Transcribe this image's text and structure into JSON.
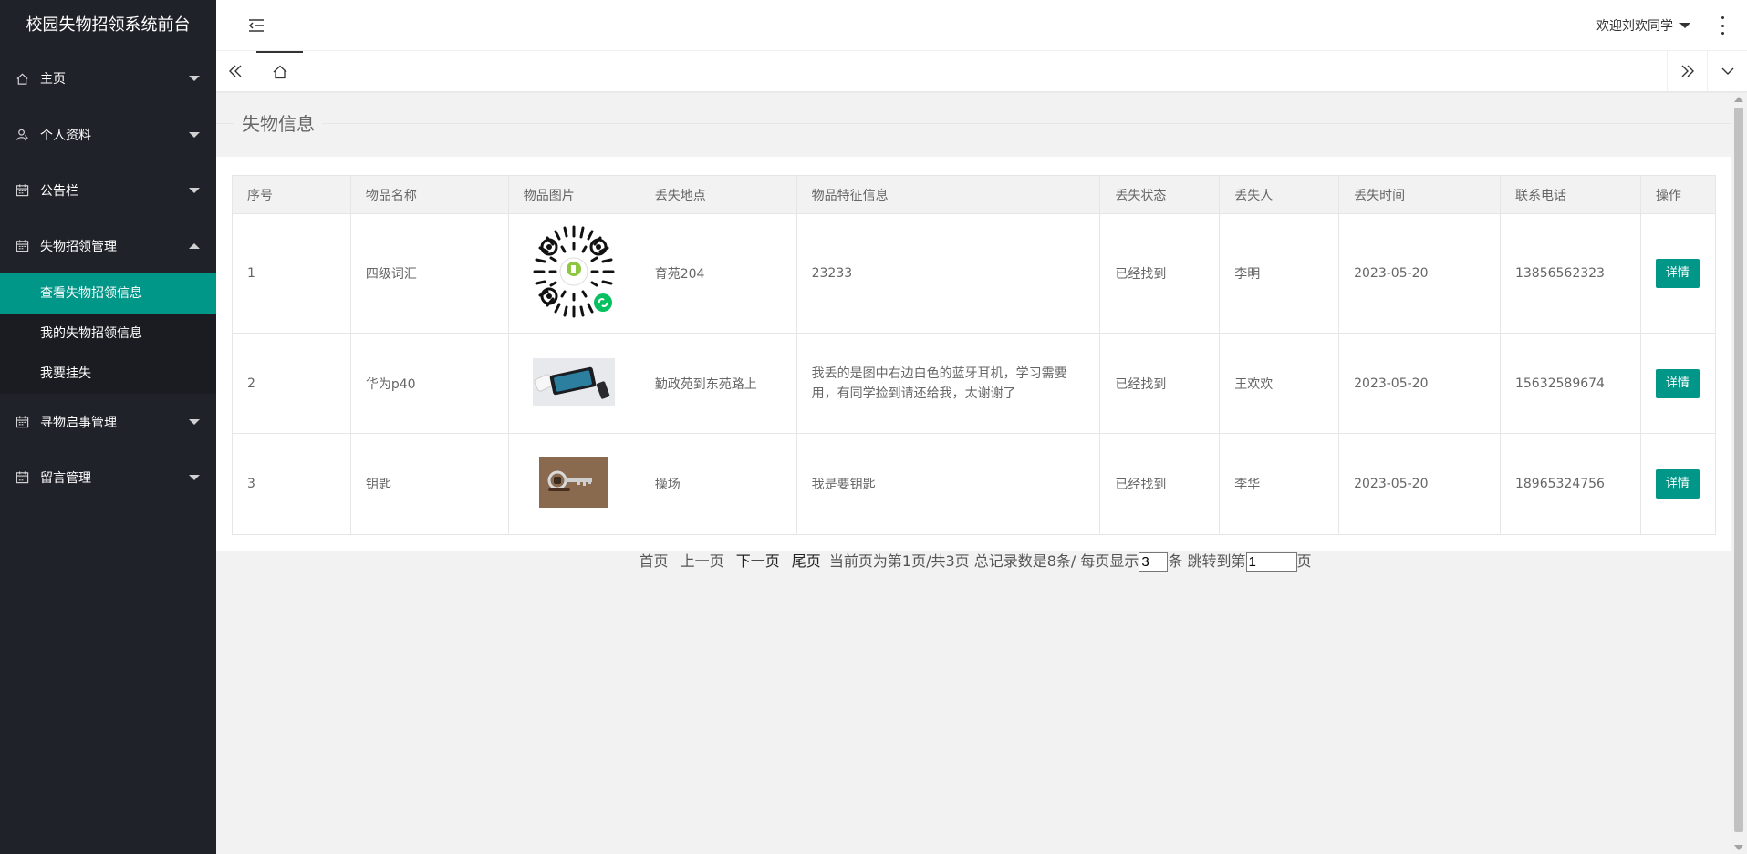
{
  "app": {
    "title": "校园失物招领系统前台"
  },
  "colors": {
    "accent": "#009688",
    "sidebar_bg": "#20222a",
    "sidebar_sub_bg": "#1b1c22"
  },
  "sidebar": {
    "items": [
      {
        "label": "主页",
        "icon": "home-icon"
      },
      {
        "label": "个人资料",
        "icon": "user-icon"
      },
      {
        "label": "公告栏",
        "icon": "calendar-icon"
      },
      {
        "label": "失物招领管理",
        "icon": "calendar-icon"
      },
      {
        "label": "寻物启事管理",
        "icon": "calendar-icon"
      },
      {
        "label": "留言管理",
        "icon": "calendar-icon"
      }
    ],
    "subitems": [
      {
        "label": "查看失物招领信息"
      },
      {
        "label": "我的失物招领信息"
      },
      {
        "label": "我要挂失"
      }
    ]
  },
  "header": {
    "welcome": "欢迎刘欢同学"
  },
  "page": {
    "title": "失物信息"
  },
  "table": {
    "headers": [
      "序号",
      "物品名称",
      "物品图片",
      "丢失地点",
      "物品特征信息",
      "丢失状态",
      "丢失人",
      "丢失时间",
      "联系电话",
      "操作"
    ],
    "rows": [
      {
        "no": "1",
        "name": "四级词汇",
        "image": "qr-code-image",
        "place": "育苑204",
        "feature": "23233",
        "status": "已经找到",
        "person": "李明",
        "date": "2023-05-20",
        "phone": "13856562323",
        "action": "详情"
      },
      {
        "no": "2",
        "name": "华为p40",
        "image": "phone-image",
        "place": "勤政苑到东苑路上",
        "feature": "我丢的是图中右边白色的蓝牙耳机，学习需要用，有同学捡到请还给我，太谢谢了",
        "status": "已经找到",
        "person": "王欢欢",
        "date": "2023-05-20",
        "phone": "15632589674",
        "action": "详情"
      },
      {
        "no": "3",
        "name": "钥匙",
        "image": "key-image",
        "place": "操场",
        "feature": "我是要钥匙",
        "status": "已经找到",
        "person": "李华",
        "date": "2023-05-20",
        "phone": "18965324756",
        "action": "详情"
      }
    ]
  },
  "pager": {
    "first": "首页",
    "prev": "上一页",
    "next": "下一页",
    "last": "尾页",
    "info": "当前页为第1页/共3页 总记录数是8条/ 每页显示",
    "per_page_value": "3",
    "unit": "条 跳转到第",
    "jump_value": "1",
    "page_unit": "页"
  }
}
